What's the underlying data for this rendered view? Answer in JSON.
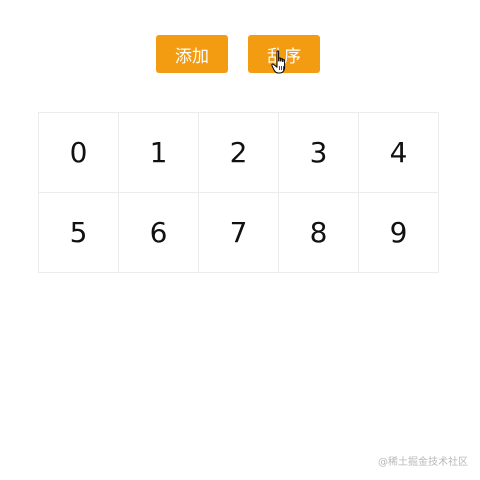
{
  "toolbar": {
    "add_label": "添加",
    "shuffle_label": "乱序",
    "button_color": "#f39c12"
  },
  "grid": {
    "cells": [
      "0",
      "1",
      "2",
      "3",
      "4",
      "5",
      "6",
      "7",
      "8",
      "9"
    ]
  },
  "cursor": {
    "icon": "hand-pointer-icon"
  },
  "watermark": {
    "text": "@稀土掘金技术社区"
  }
}
